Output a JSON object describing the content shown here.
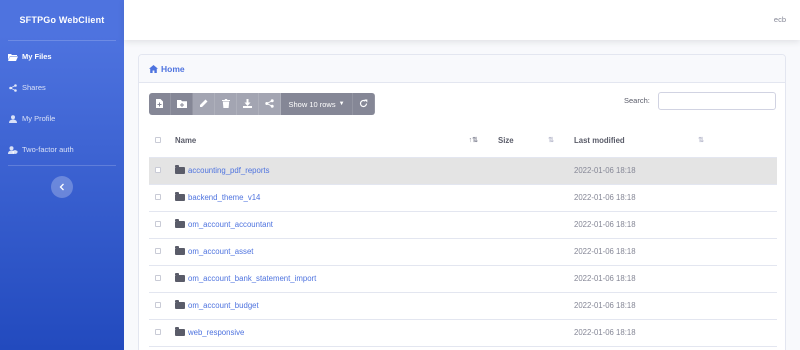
{
  "app": {
    "brand": "SFTPGo WebClient"
  },
  "sidebar": {
    "items": [
      {
        "label": "My Files",
        "icon": "folder-open-icon",
        "active": true
      },
      {
        "label": "Shares",
        "icon": "share-icon",
        "active": false
      },
      {
        "label": "My Profile",
        "icon": "user-icon",
        "active": false
      },
      {
        "label": "Two-factor auth",
        "icon": "user-shield-icon",
        "active": false
      }
    ],
    "toggle_icon": "chevron-left-icon"
  },
  "topbar": {
    "username": "ecb"
  },
  "breadcrumb": {
    "label": "Home",
    "icon": "home-icon"
  },
  "toolbar": {
    "buttons": [
      "new-file-icon",
      "new-folder-icon",
      "rename-icon",
      "delete-icon",
      "download-icon",
      "share-icon"
    ],
    "rows_label": "Show 10 rows",
    "refresh_icon": "refresh-icon"
  },
  "search": {
    "label": "Search:",
    "value": "",
    "placeholder": ""
  },
  "table": {
    "columns": {
      "name": "Name",
      "size": "Size",
      "modified": "Last modified"
    },
    "rows": [
      {
        "name": "accounting_pdf_reports",
        "size": "",
        "modified": "2022-01-06 18:18",
        "selected": true
      },
      {
        "name": "backend_theme_v14",
        "size": "",
        "modified": "2022-01-06 18:18",
        "selected": false
      },
      {
        "name": "om_account_accountant",
        "size": "",
        "modified": "2022-01-06 18:18",
        "selected": false
      },
      {
        "name": "om_account_asset",
        "size": "",
        "modified": "2022-01-06 18:18",
        "selected": false
      },
      {
        "name": "om_account_bank_statement_import",
        "size": "",
        "modified": "2022-01-06 18:18",
        "selected": false
      },
      {
        "name": "om_account_budget",
        "size": "",
        "modified": "2022-01-06 18:18",
        "selected": false
      },
      {
        "name": "web_responsive",
        "size": "",
        "modified": "2022-01-06 18:18",
        "selected": false
      }
    ]
  },
  "colors": {
    "primary": "#4e73df",
    "sidebar_bottom": "#224abe",
    "toolbar": "#858796",
    "selected_row": "#e4e4e4"
  }
}
